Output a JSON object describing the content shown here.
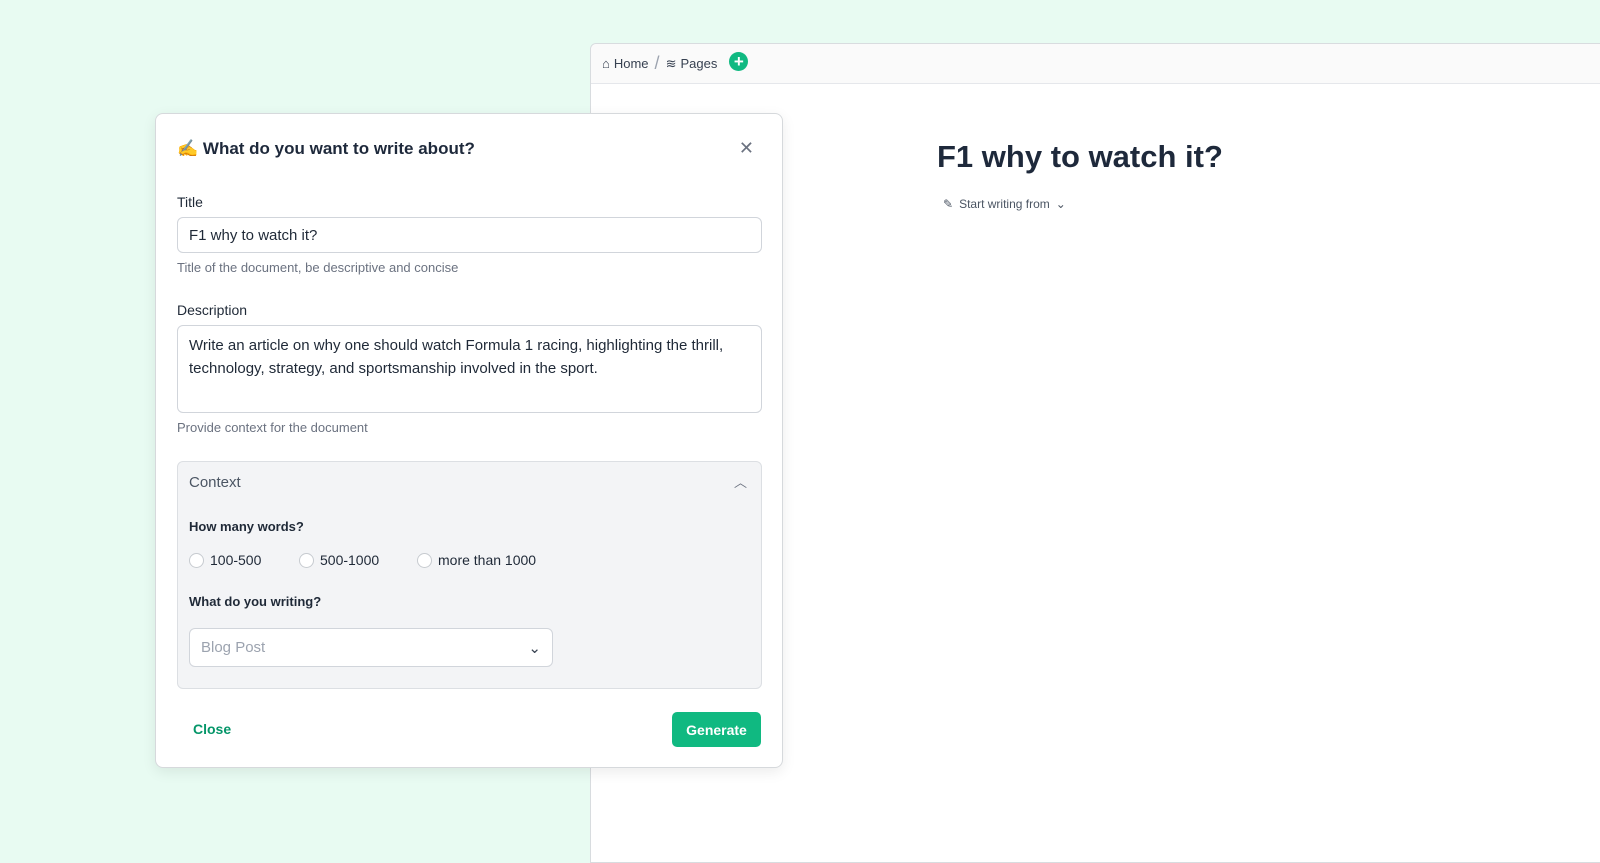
{
  "editor": {
    "breadcrumb": [
      {
        "label": "Home",
        "icon": "home-icon"
      },
      {
        "label": "Pages",
        "icon": "layers-icon"
      }
    ],
    "doc_title": "F1 why to watch it?",
    "start_writing": "Start writing from"
  },
  "modal": {
    "emoji": "✍️",
    "title": "What do you want to write about?",
    "title_label": "Title",
    "title_value": "F1 why to watch it?",
    "title_help": "Title of the document, be descriptive and concise",
    "desc_label": "Description",
    "desc_value": "Write an article on why one should watch Formula 1 racing, highlighting the thrill, technology, strategy, and sportsmanship involved in the sport.",
    "desc_help": "Provide context for the document",
    "context": {
      "header": "Context",
      "words_q": "How many words?",
      "options": [
        "100-500",
        "500-1000",
        "more than 1000"
      ],
      "type_q": "What do you writing?",
      "type_value": "Blog Post"
    },
    "close": "Close",
    "generate": "Generate"
  },
  "colors": {
    "accent": "#10b981",
    "background": "#e8fbf2"
  }
}
